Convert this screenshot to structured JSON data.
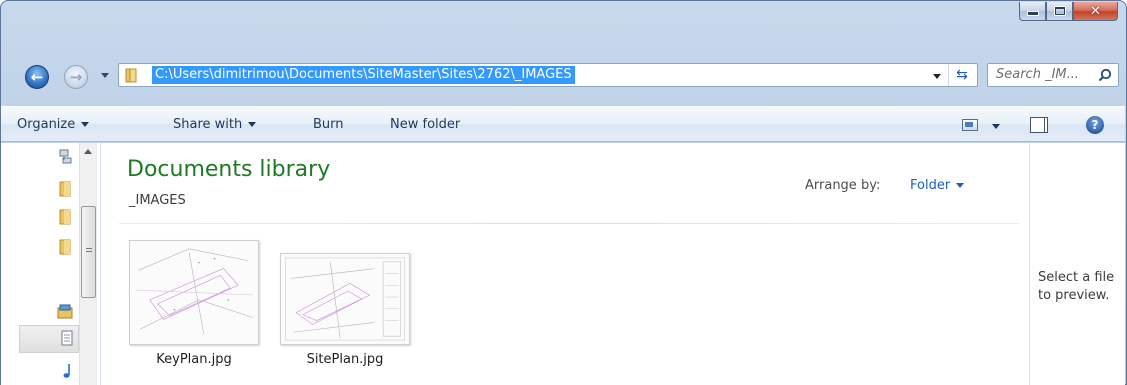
{
  "window": {
    "caption_buttons": {
      "minimize": "minimize",
      "maximize": "maximize",
      "close": "✕"
    }
  },
  "address": {
    "path": "C:\\Users\\dimitrimou\\Documents\\SiteMaster\\Sites\\2762\\_IMAGES",
    "refresh_glyph": "⇆"
  },
  "search": {
    "placeholder": "Search _IM..."
  },
  "toolbar": {
    "organize": "Organize",
    "share_with": "Share with",
    "burn": "Burn",
    "new_folder": "New folder",
    "help_glyph": "?"
  },
  "library": {
    "title": "Documents library",
    "subtitle": "_IMAGES",
    "arrange_label": "Arrange by:",
    "arrange_value": "Folder"
  },
  "files": [
    {
      "name": "KeyPlan.jpg",
      "icon": "image-thumbnail"
    },
    {
      "name": "SitePlan.jpg",
      "icon": "image-thumbnail"
    }
  ],
  "preview": {
    "text": "Select a file to preview."
  },
  "nav_icons": [
    "network-icon",
    "folder-icon",
    "folder-icon",
    "folder-icon",
    "libraries-icon",
    "documents-icon",
    "music-icon"
  ],
  "colors": {
    "accent": "#3399ff",
    "library_title": "#1e7a23",
    "link": "#1e5ebe"
  }
}
